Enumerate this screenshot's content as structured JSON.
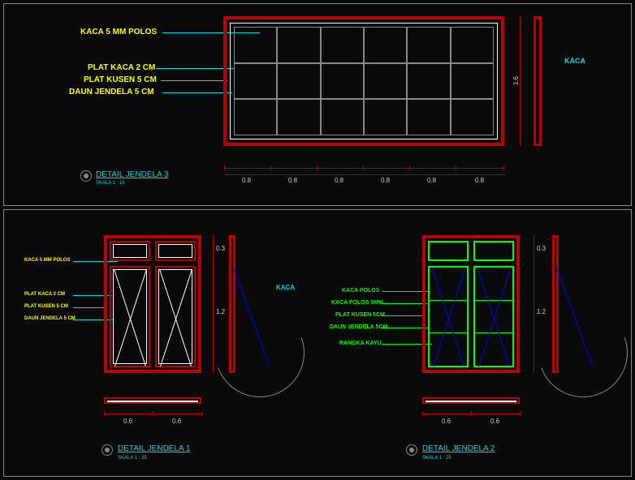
{
  "detail3": {
    "labels": {
      "l1": "KACA 5 MM POLOS",
      "l2": "PLAT KACA 2 CM",
      "l3": "PLAT KUSEN 5 CM",
      "l4": "DAUN JENDELA 5 CM"
    },
    "title": "DETAIL  JENDELA  3",
    "scale": "SKALA 1 : 15",
    "side_label": "KACA",
    "dim_side": "1.6",
    "dims_bottom": [
      "0.8",
      "0.8",
      "0.8",
      "0.8",
      "0.8",
      "0.8"
    ]
  },
  "detail1": {
    "labels": {
      "l1": "KACA 5 MM POLOS",
      "l2": "PLAT KACA 2 CM",
      "l3": "PLAT KUSEN 5 CM",
      "l4": "DAUN JENDELA 5 CM"
    },
    "title": "DETAIL  JENDELA  1",
    "scale": "SKALA 1 : 25",
    "side_label": "KACA",
    "dim_top": "0.3",
    "dim_side": "1.2",
    "dims_bottom": [
      "0.6",
      "0.6"
    ]
  },
  "detail2": {
    "labels": {
      "l1": "KACA POLOS",
      "l2": "KACA POLOS 5MM",
      "l3": "PLAT KUSEN 5CM",
      "l4": "DAUN JENDELA 5CM",
      "l5": "RANGKA KAYU"
    },
    "title": "DETAIL  JENDELA  2",
    "scale": "SKALA 1 : 25",
    "dim_top": "0.3",
    "dim_side": "1.2",
    "dims_bottom": [
      "0.6",
      "0.6"
    ]
  }
}
